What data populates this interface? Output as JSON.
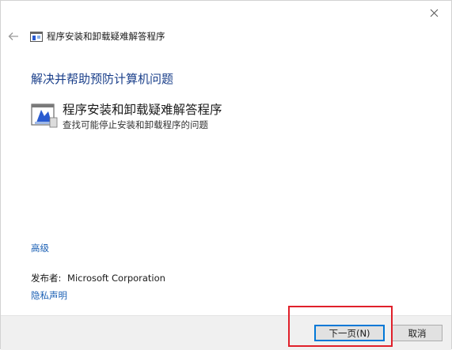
{
  "window": {
    "title": "程序安装和卸载疑难解答程序"
  },
  "icons": {
    "close": "close-icon",
    "back": "back-arrow-icon",
    "app": "troubleshooter-app-icon",
    "item": "installer-troubleshoot-icon"
  },
  "main": {
    "heading": "解决并帮助预防计算机问题",
    "item": {
      "title": "程序安装和卸载疑难解答程序",
      "description": "查找可能停止安装和卸载程序的问题"
    },
    "advanced_link": "高级",
    "publisher_label": "发布者:",
    "publisher_value": "Microsoft Corporation",
    "privacy_link": "隐私声明"
  },
  "footer": {
    "next_button": "下一页(N)",
    "cancel_button": "取消"
  },
  "colors": {
    "heading": "#1a3f8a",
    "link": "#1a5fb4",
    "focus_border": "#0078d7",
    "highlight": "#e0202a",
    "footer_bg": "#f0f0f0"
  }
}
